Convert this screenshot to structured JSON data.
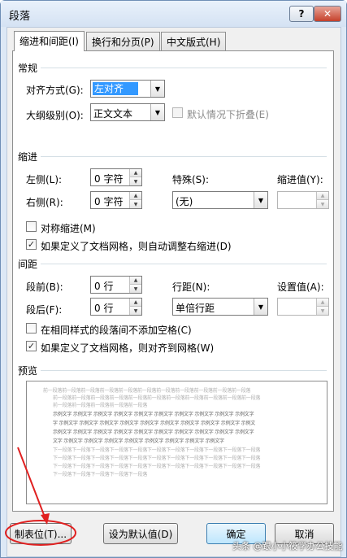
{
  "window": {
    "title": "段落",
    "help_label": "?",
    "close_label": "✕"
  },
  "tabs": [
    {
      "label": "缩进和间距(I)"
    },
    {
      "label": "换行和分页(P)"
    },
    {
      "label": "中文版式(H)"
    }
  ],
  "general": {
    "section": "常规",
    "alignment_label": "对齐方式(G):",
    "alignment_value": "左对齐",
    "outline_label": "大纲级别(O):",
    "outline_value": "正文文本",
    "collapse_label": "默认情况下折叠(E)"
  },
  "indent": {
    "section": "缩进",
    "left_label": "左侧(L):",
    "left_value": "0 字符",
    "right_label": "右侧(R):",
    "right_value": "0 字符",
    "special_label": "特殊(S):",
    "special_value": "(无)",
    "by_label": "缩进值(Y):",
    "mirror_label": "对称缩进(M)",
    "auto_adjust_label": "如果定义了文档网格，则自动调整右缩进(D)"
  },
  "spacing": {
    "section": "间距",
    "before_label": "段前(B):",
    "before_value": "0 行",
    "after_label": "段后(F):",
    "after_value": "0 行",
    "line_label": "行距(N):",
    "line_value": "单倍行距",
    "at_label": "设置值(A):",
    "no_space_label": "在相同样式的段落间不添加空格(C)",
    "snap_grid_label": "如果定义了文档网格，则对齐到网格(W)"
  },
  "preview": {
    "section": "预览",
    "lines": [
      "前一段落前一段落前一段落前一段落前一段落前一段落前一段落前一段落前一段落前一段落前一段落",
      "前一段落前一段落前一段落前一段落前一段落前一段落前一段落前一段落前一段落前一段落前一段落",
      "前一段落前一段落前一段落前一段落前一段落",
      "示例文字 示例文字 示例文字 示例文字 示例文字 示例文字 示例文字 示例文字 示例文字 示例文字",
      "字 示例文字 示例文字 示例文字 示例文字 示例文字 示例文字 示例文字 示例文字 示例文字 示例文",
      "示例文字 示例文字 示例文字 示例文字 示例文字 示例文字 示例文字 示例文字 示例文字 示例文字",
      "文字 示例文字 示例文字 示例文字 示例文字 示例文字 示例文字 示例文字 示例文字",
      "下一段落下一段落下一段落下一段落下一段落下一段落下一段落下一段落下一段落下一段落下一段落",
      "下一段落下一段落下一段落下一段落下一段落下一段落下一段落下一段落下一段落下一段落下一段落",
      "下一段落下一段落下一段落下一段落下一段落下一段落下一段落下一段落下一段落下一段落下一段落",
      "下一段落下一段落下一段落下一段落下一段落"
    ]
  },
  "buttons": {
    "tabs": "制表位(T)...",
    "set_default": "设为默认值(D)",
    "ok": "确定",
    "cancel": "取消"
  },
  "watermark": "头条 @跟小小筱学办公技能",
  "colors": {
    "annotation": "#e02020"
  }
}
